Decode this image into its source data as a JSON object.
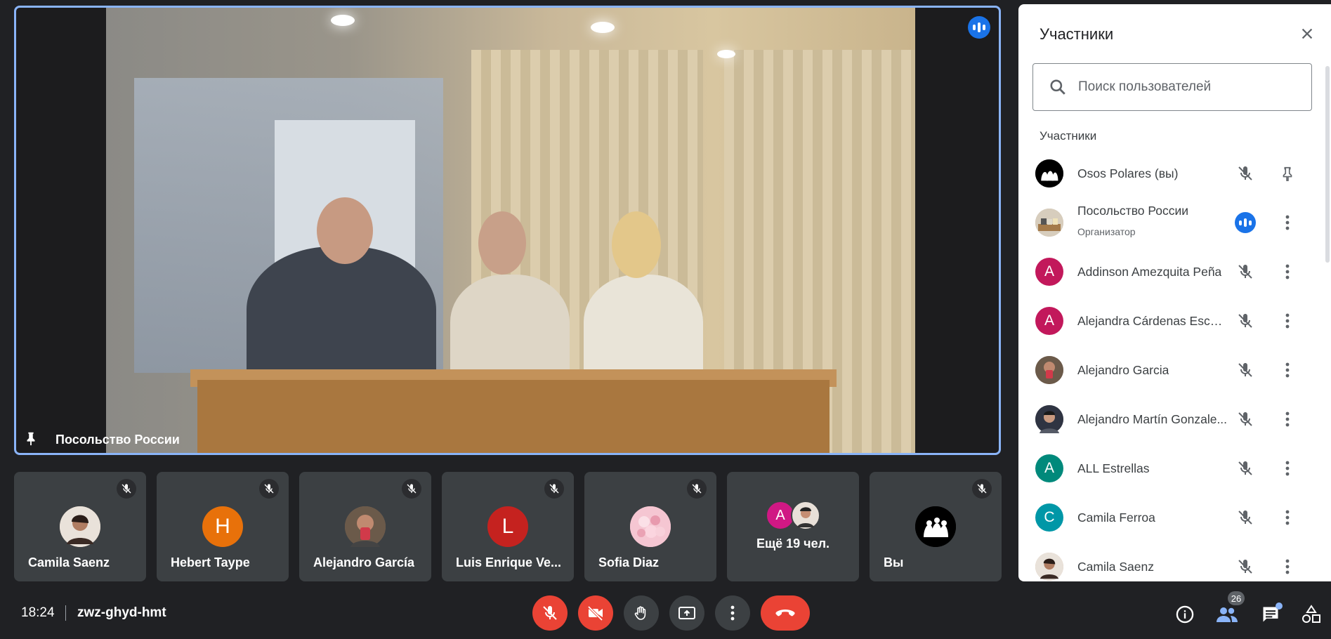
{
  "main_video": {
    "speaker_name": "Посольство России"
  },
  "thumbnails": [
    {
      "name": "Camila Saenz",
      "avatar_type": "photo",
      "avatar_color": "#c9a48a",
      "muted": true
    },
    {
      "name": "Hebert Taype",
      "avatar_type": "letter",
      "initial": "H",
      "avatar_color": "#e8710a",
      "muted": true
    },
    {
      "name": "Alejandro García",
      "avatar_type": "photo",
      "avatar_color": "#8a6b5a",
      "muted": true
    },
    {
      "name": "Luis Enrique Ve...",
      "avatar_type": "letter",
      "initial": "L",
      "avatar_color": "#c5221f",
      "muted": true
    },
    {
      "name": "Sofia Diaz",
      "avatar_type": "photo",
      "avatar_color": "#f2b8c6",
      "muted": true
    },
    {
      "more_label": "Ещё 19 чел.",
      "avatars": [
        {
          "initial": "A",
          "color": "#d01884"
        },
        {
          "initial": "",
          "color": "#e8e0d8"
        }
      ]
    },
    {
      "name": "Вы",
      "avatar_type": "photo",
      "avatar_color": "#000000",
      "muted": true
    }
  ],
  "panel": {
    "title": "Участники",
    "search_placeholder": "Поиск пользователей",
    "section_label": "Участники",
    "participants": [
      {
        "name": "Osos Polares (вы)",
        "avatar_type": "photo",
        "color": "#000000",
        "action": "pin"
      },
      {
        "name": "Посольство России",
        "subtitle": "Организатор",
        "avatar_type": "photo",
        "color": "#b9a58c",
        "speaking": true
      },
      {
        "name": "Addinson Amezquita Peña",
        "avatar_type": "letter",
        "initial": "A",
        "color": "#c2185b"
      },
      {
        "name": "Alejandra Cárdenas Escal...",
        "avatar_type": "letter",
        "initial": "A",
        "color": "#c2185b"
      },
      {
        "name": "Alejandro Garcia",
        "avatar_type": "photo",
        "color": "#7a5c4c"
      },
      {
        "name": "Alejandro Martín Gonzale...",
        "avatar_type": "photo",
        "color": "#3c3f4a"
      },
      {
        "name": "ALL Estrellas",
        "avatar_type": "letter",
        "initial": "A",
        "color": "#00897b"
      },
      {
        "name": "Camila Ferroa",
        "avatar_type": "letter",
        "initial": "C",
        "color": "#0097a7"
      },
      {
        "name": "Camila Saenz",
        "avatar_type": "photo",
        "color": "#c9a48a"
      }
    ]
  },
  "bottom_bar": {
    "time": "18:24",
    "meeting_code": "zwz-ghyd-hmt",
    "participant_count": "26"
  },
  "colors": {
    "background": "#202124",
    "accent": "#8ab4f8",
    "danger": "#ea4335",
    "speaking": "#1a73e8"
  }
}
